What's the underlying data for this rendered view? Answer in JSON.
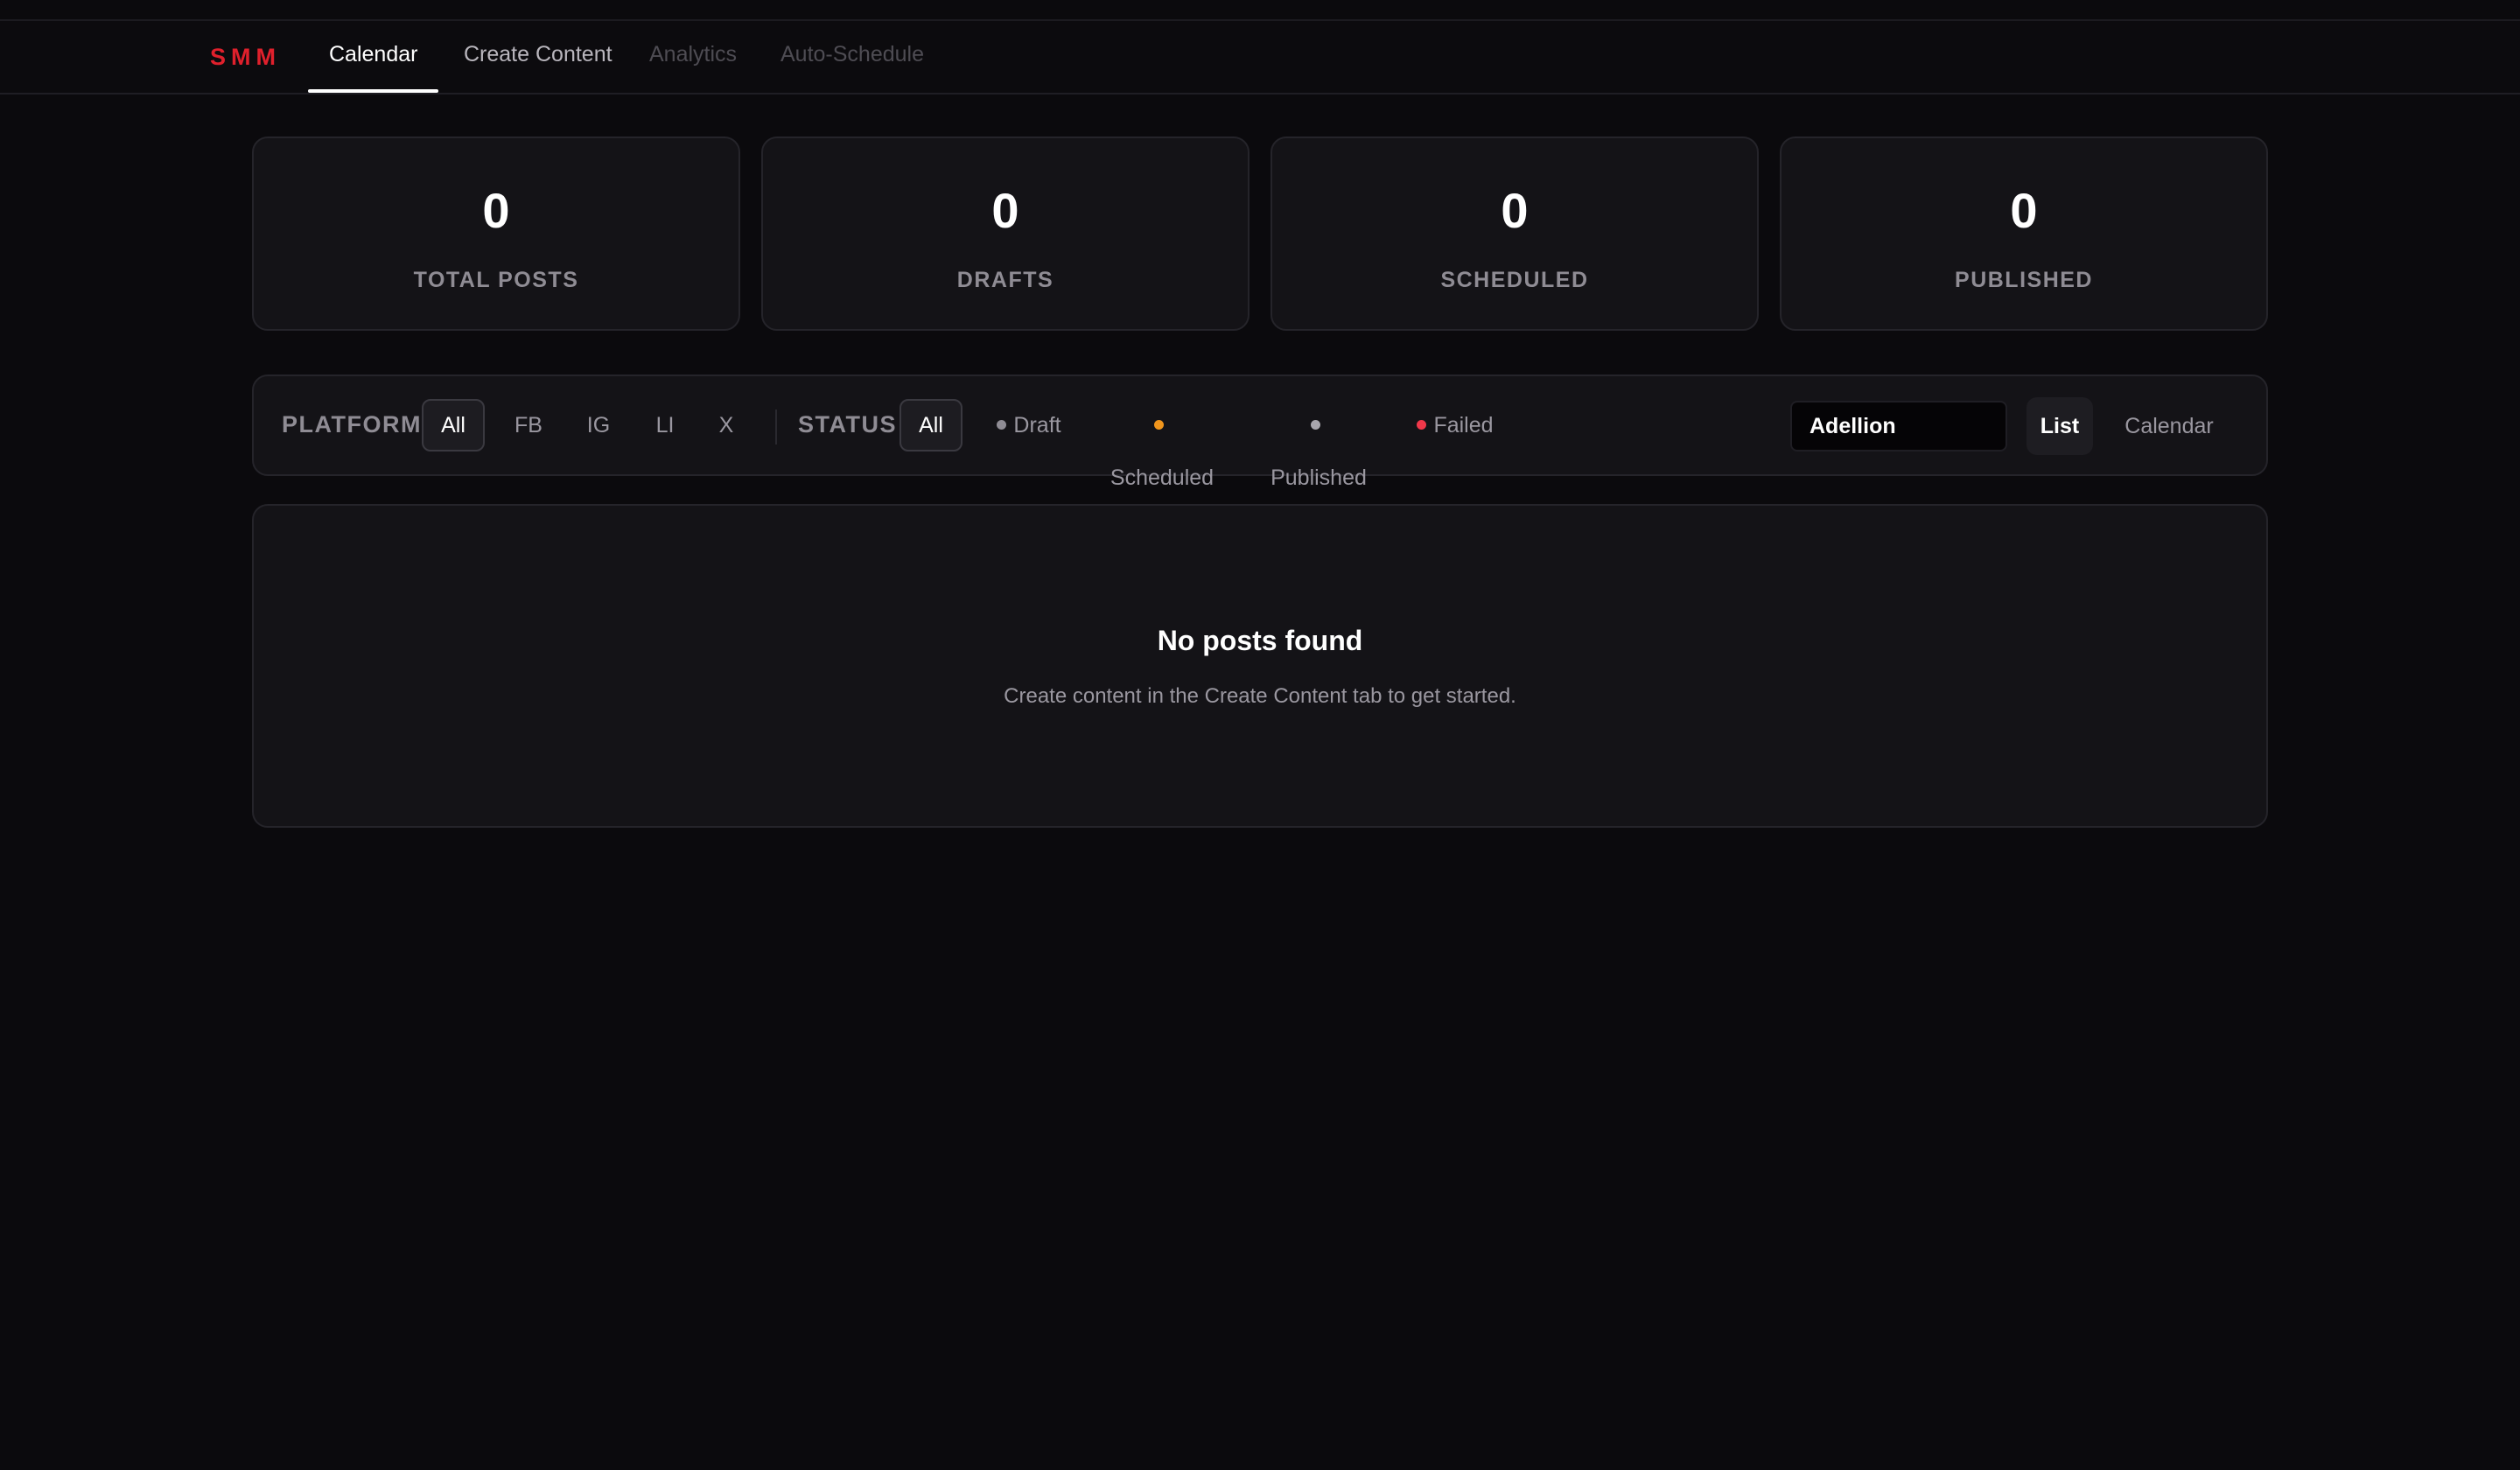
{
  "nav": {
    "brand": "SMM",
    "tabs": [
      {
        "label": "Calendar",
        "state": "active"
      },
      {
        "label": "Create Content",
        "state": "normal"
      },
      {
        "label": "Analytics",
        "state": "disabled"
      },
      {
        "label": "Auto-Schedule",
        "state": "disabled"
      }
    ]
  },
  "stats": [
    {
      "value": "0",
      "label": "TOTAL POSTS"
    },
    {
      "value": "0",
      "label": "DRAFTS"
    },
    {
      "value": "0",
      "label": "SCHEDULED"
    },
    {
      "value": "0",
      "label": "PUBLISHED"
    }
  ],
  "filters": {
    "platform_label": "PLATFORM",
    "platforms": [
      "All",
      "FB",
      "IG",
      "LI",
      "X"
    ],
    "platform_selected": "All",
    "status_label": "STATUS",
    "statuses": [
      {
        "label": "All"
      },
      {
        "label": "Draft",
        "color": "#8f8c94"
      },
      {
        "label": "Scheduled",
        "color": "#f0951c"
      },
      {
        "label": "Published",
        "color": "#a8a6ad"
      },
      {
        "label": "Failed",
        "color": "#f0384a"
      }
    ],
    "status_selected": "All",
    "search_value": "Adellion",
    "views": [
      "List",
      "Calendar"
    ],
    "view_selected": "List"
  },
  "empty_state": {
    "title": "No posts found",
    "subtitle": "Create content in the Create Content tab to get started."
  },
  "colors": {
    "brand": "#e0202c",
    "background": "#0b0a0d",
    "card": "#141317"
  }
}
